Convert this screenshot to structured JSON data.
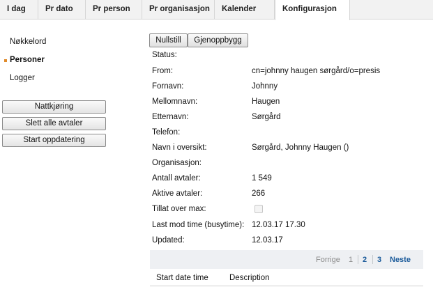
{
  "tabs": [
    {
      "label": "I dag"
    },
    {
      "label": "Pr dato"
    },
    {
      "label": "Pr person"
    },
    {
      "label": "Pr organisasjon"
    },
    {
      "label": "Kalender"
    },
    {
      "label": "Konfigurasjon"
    }
  ],
  "sidebar": {
    "items": [
      {
        "label": "Nøkkelord"
      },
      {
        "label": "Personer"
      },
      {
        "label": "Logger"
      }
    ],
    "buttons": [
      {
        "label": "Nattkjøring"
      },
      {
        "label": "Slett alle avtaler"
      },
      {
        "label": "Start oppdatering"
      }
    ]
  },
  "toolbar": {
    "reset_label": "Nullstill",
    "rebuild_label": "Gjenoppbygg"
  },
  "details": {
    "status_label": "Status:",
    "from_label": "From:",
    "from_value": "cn=johnny haugen sørgård/o=presis",
    "fornavn_label": "Fornavn:",
    "fornavn_value": "Johnny",
    "mellomnavn_label": "Mellomnavn:",
    "mellomnavn_value": "Haugen",
    "etternavn_label": "Etternavn:",
    "etternavn_value": "Sørgård",
    "telefon_label": "Telefon:",
    "navn_label": "Navn i oversikt:",
    "navn_value": "Sørgård, Johnny Haugen ()",
    "org_label": "Organisasjon:",
    "antall_label": "Antall avtaler:",
    "antall_value": "1 549",
    "aktive_label": "Aktive avtaler:",
    "aktive_value": "266",
    "tillat_label": "Tillat over max:",
    "tillat_checked": false,
    "lastmod_label": "Last mod time (busytime):",
    "lastmod_value": "12.03.17 17.30",
    "updated_label": "Updated:",
    "updated_value": "12.03.17"
  },
  "pager": {
    "prev": "Forrige",
    "pages": [
      "1",
      "2",
      "3"
    ],
    "current_page": "1",
    "next": "Neste"
  },
  "table": {
    "columns": [
      "Start date time",
      "Description"
    ]
  },
  "colors": {
    "accent_bullet": "#e08a2a",
    "link": "#1a5a9a",
    "pager_bg": "#eef0f3"
  }
}
